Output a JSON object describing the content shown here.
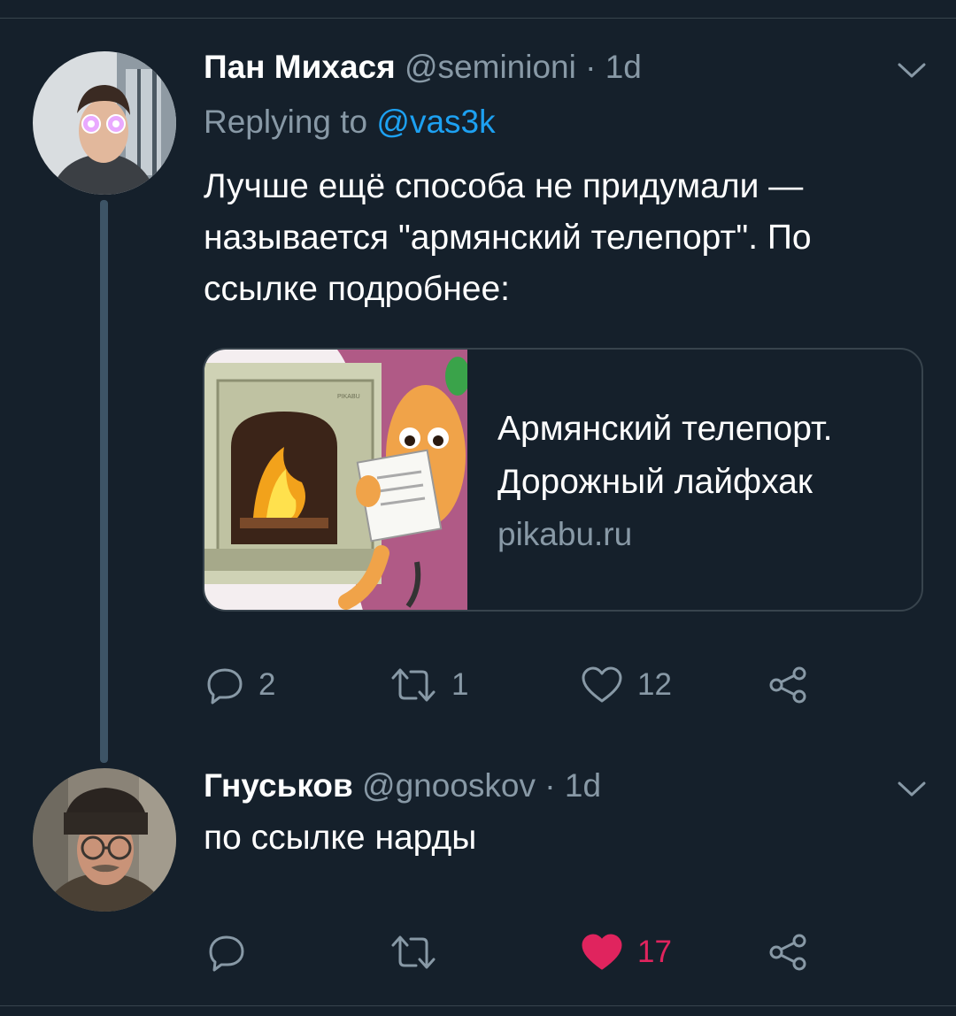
{
  "tweets": [
    {
      "author_name": "Пан Михася",
      "handle": "@seminioni",
      "separator": "·",
      "time": "1d",
      "replying_prefix": "Replying to",
      "replying_to": "@vas3k",
      "text_lines": [
        "Лучше ещё способа не придумали —",
        "называется \"армянский телепорт\". По",
        "ссылке подробнее:"
      ],
      "card": {
        "title_line1": "Армянский телепорт.",
        "title_line2": "Дорожный лайфхак",
        "domain": "pikabu.ru",
        "image_label": "PIKABU"
      },
      "actions": {
        "replies": "2",
        "retweets": "1",
        "likes": "12",
        "liked": false
      }
    },
    {
      "author_name": "Гнуськов",
      "handle": "@gnooskov",
      "separator": "·",
      "time": "1d",
      "text_lines": [
        "по ссылке нарды"
      ],
      "actions": {
        "replies": "",
        "retweets": "",
        "likes": "17",
        "liked": true
      }
    }
  ],
  "colors": {
    "background": "#15202b",
    "secondary_text": "#8899a6",
    "link": "#1da1f2",
    "like_active": "#e0245e",
    "divider": "#38444d"
  },
  "icons": [
    "reply-icon",
    "retweet-icon",
    "like-icon",
    "share-icon",
    "chevron-down-icon"
  ]
}
